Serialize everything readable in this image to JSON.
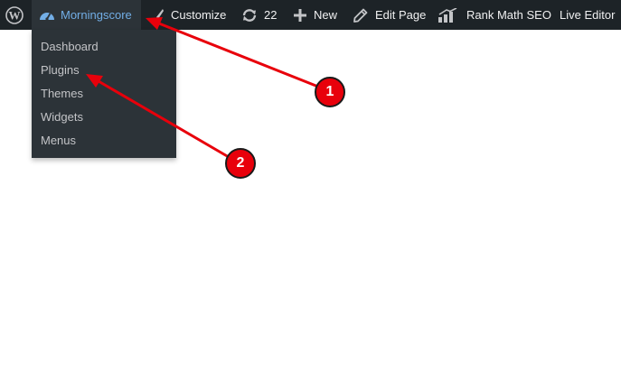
{
  "admin_bar": {
    "wordpress_icon": "wordpress-logo-icon",
    "site_name": "Morningscore",
    "site_icon": "dashboard-gauge-icon",
    "customize": "Customize",
    "customize_icon": "paintbrush-icon",
    "updates_count": "22",
    "updates_icon": "refresh-icon",
    "new": "New",
    "new_icon": "plus-icon",
    "edit_page": "Edit Page",
    "edit_icon": "pencil-icon",
    "rank_math": "Rank Math SEO",
    "rank_math_icon": "rank-math-chart-icon",
    "live_editor": "Live Editor"
  },
  "site_menu": {
    "items": [
      "Dashboard",
      "Plugins",
      "Themes",
      "Widgets",
      "Menus"
    ]
  },
  "annotations": {
    "badges": [
      "1",
      "2"
    ],
    "color": "#e8000b"
  },
  "colors": {
    "admin_bar_bg": "#1d2327",
    "submenu_bg": "#2c3338",
    "link_blue": "#72aee6"
  }
}
